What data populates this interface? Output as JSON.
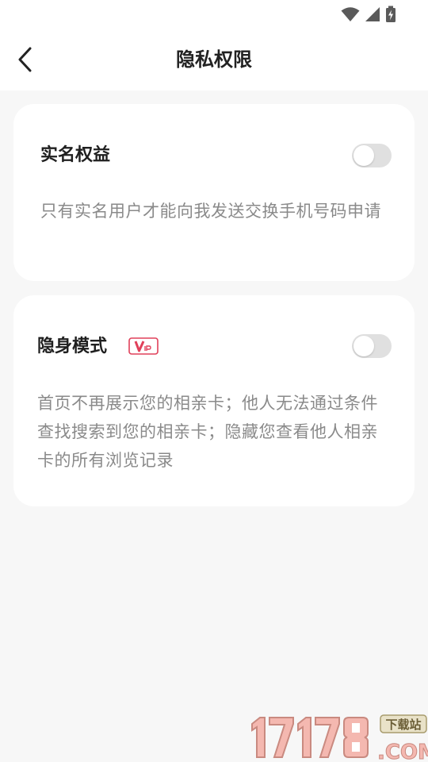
{
  "status_bar": {
    "icons": [
      "wifi-icon",
      "signal-icon",
      "battery-charging-icon"
    ]
  },
  "header": {
    "back_icon": "chevron-left-icon",
    "title": "隐私权限"
  },
  "settings": [
    {
      "title": "实名权益",
      "description": "只有实名用户才能向我发送交换手机号码申请",
      "enabled": false
    },
    {
      "title": "隐身模式",
      "badge": "VIP",
      "description": "首页不再展示您的相亲卡；他人无法通过条件查找搜索到您的相亲卡；隐藏您查看他人相亲卡的所有浏览记录",
      "enabled": false
    }
  ],
  "watermark": {
    "number": "17178",
    "suffix": ".COM",
    "tag": "下载站"
  },
  "colors": {
    "page_background": "#f7f7f7",
    "card_background": "#ffffff",
    "toggle_off": "#e0e0e0",
    "vip_accent": "#e0405a",
    "text_primary": "#222222",
    "text_secondary": "#8a8a8a"
  }
}
